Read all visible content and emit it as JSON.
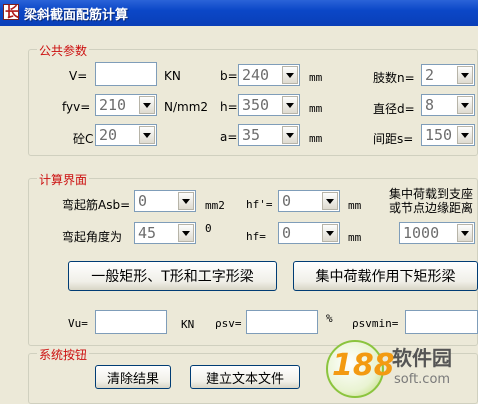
{
  "window": {
    "title": "梁斜截面配筋计算",
    "icon_glyph": "长"
  },
  "groups": {
    "public": "公共参数",
    "calc": "计算界面",
    "system": "系统按钮"
  },
  "public": {
    "v_label": "V=",
    "v_value": "",
    "v_unit": "KN",
    "b_label": "b=",
    "b_value": "240",
    "b_unit": "mm",
    "legs_label": "肢数n=",
    "legs_value": "2",
    "fyv_label": "fyv=",
    "fyv_value": "210",
    "fyv_unit": "N/mm2",
    "h_label": "h=",
    "h_value": "350",
    "h_unit": "mm",
    "dia_label": "直径d=",
    "dia_value": "8",
    "concrete_label": "砼C",
    "concrete_value": "20",
    "a_label": "a=",
    "a_value": "35",
    "a_unit": "mm",
    "spacing_label": "间距s=",
    "spacing_value": "150"
  },
  "calc": {
    "asb_label": "弯起筋Asb=",
    "asb_value": "0",
    "asb_unit": "mm2",
    "hf1_label": "hf'=",
    "hf1_value": "0",
    "hf1_unit": "mm",
    "conc_note_line1": "集中荷载到支座",
    "conc_note_line2": "或节点边缘距离",
    "angle_label": "弯起角度为",
    "angle_value": "45",
    "angle_unit": "0",
    "hf2_label": "hf=",
    "hf2_value": "0",
    "hf2_unit": "mm",
    "dist_value": "1000",
    "btn_general": "一般矩形、T形和工字形梁",
    "btn_concentrated": "集中荷载作用下矩形梁",
    "vu_label": "Vu=",
    "vu_value": "",
    "vu_unit": "KN",
    "psv_label": "ρsv=",
    "psv_value": "",
    "psv_unit": "%",
    "psvmin_label": "ρsvmin="
  },
  "system": {
    "btn_clear": "清除结果",
    "btn_text": "建立文本文件"
  },
  "watermark": {
    "num": "188",
    "name": "软件园",
    "site": "soft.com"
  },
  "colors": {
    "group_title": "#cc1010",
    "titlebar": "#0b47c7",
    "dialog_bg": "#ece9d8"
  }
}
